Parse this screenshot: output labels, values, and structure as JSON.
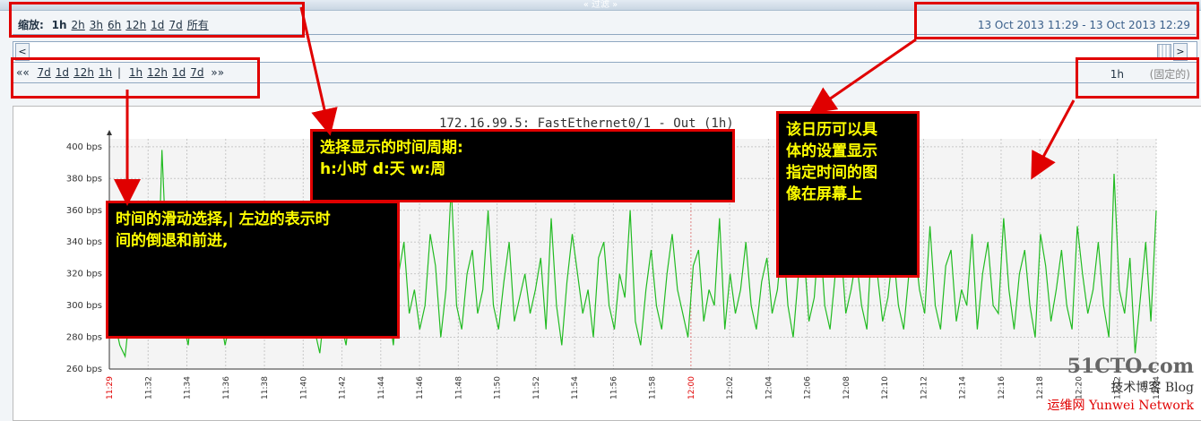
{
  "filter": {
    "label": "« 过滤 »"
  },
  "zoom": {
    "label": "缩放:",
    "options": [
      "1h",
      "2h",
      "3h",
      "6h",
      "12h",
      "1d",
      "7d",
      "所有"
    ],
    "active": "1h"
  },
  "range": {
    "start": "13 Oct 2013 11:29",
    "sep": " - ",
    "end": "13 Oct 2013 12:29"
  },
  "scroll": {
    "left": "<",
    "right": ">"
  },
  "nav": {
    "back_symbol": "««",
    "back": [
      "7d",
      "1d",
      "12h",
      "1h"
    ],
    "separator": "|",
    "forward": [
      "1h",
      "12h",
      "1d",
      "7d"
    ],
    "forward_symbol": "»»",
    "period": "1h",
    "fixed": "(固定的)"
  },
  "annotations": {
    "zoom_note": [
      "选择显示的时间周期:",
      "h:小时   d:天    w:周"
    ],
    "slide_note": [
      "时间的滑动选择,| 左边的表示时",
      "间的倒退和前进,"
    ],
    "calendar_note": [
      "该日历可以具",
      "体的设置显示",
      "指定时间的图",
      "像在屏幕上"
    ]
  },
  "watermark": {
    "main": "51CTO.com",
    "sub": "技术博客",
    "blog": "Blog",
    "brand": "运维网",
    "footer": "Yunwei Network"
  },
  "chart_data": {
    "type": "line",
    "title": "172.16.99.5: FastEthernet0/1 - Out (1h)",
    "y_tick_labels": [
      "260 bps",
      "280 bps",
      "300 bps",
      "320 bps",
      "340 bps",
      "360 bps",
      "380 bps",
      "400 bps"
    ],
    "ylim": [
      260,
      405
    ],
    "x_tick_labels": [
      "11:29",
      "11:32",
      "11:34",
      "11:36",
      "11:38",
      "11:40",
      "11:42",
      "11:44",
      "11:46",
      "11:48",
      "11:50",
      "11:52",
      "11:54",
      "11:56",
      "11:58",
      "12:00",
      "12:02",
      "12:04",
      "12:06",
      "12:08",
      "12:10",
      "12:12",
      "12:14",
      "12:16",
      "12:18",
      "12:20",
      "12:22",
      "12:24"
    ],
    "red_tick_labels": [
      "11:29",
      "12:00"
    ],
    "grid": true,
    "series": [
      {
        "color": "#22bb22",
        "values": [
          305,
          290,
          275,
          268,
          300,
          285,
          310,
          295,
          330,
          285,
          398,
          320,
          280,
          300,
          290,
          275,
          310,
          295,
          285,
          300,
          325,
          295,
          275,
          290,
          305,
          315,
          295,
          280,
          300,
          340,
          285,
          300,
          320,
          345,
          295,
          280,
          310,
          325,
          300,
          285,
          270,
          300,
          330,
          315,
          290,
          275,
          305,
          320,
          280,
          310,
          335,
          295,
          285,
          300,
          275,
          320,
          340,
          295,
          310,
          285,
          300,
          345,
          325,
          280,
          310,
          375,
          300,
          285,
          320,
          335,
          295,
          310,
          360,
          300,
          285,
          315,
          340,
          290,
          305,
          320,
          295,
          310,
          330,
          285,
          355,
          300,
          275,
          315,
          345,
          320,
          295,
          310,
          280,
          330,
          340,
          300,
          285,
          320,
          305,
          360,
          290,
          275,
          310,
          335,
          300,
          285,
          320,
          345,
          310,
          295,
          280,
          325,
          335,
          290,
          310,
          300,
          355,
          285,
          320,
          295,
          310,
          340,
          300,
          285,
          315,
          330,
          295,
          310,
          345,
          300,
          280,
          320,
          335,
          290,
          305,
          350,
          300,
          285,
          320,
          340,
          295,
          310,
          330,
          300,
          285,
          345,
          320,
          290,
          305,
          335,
          300,
          285,
          320,
          340,
          310,
          295,
          350,
          300,
          285,
          325,
          335,
          290,
          310,
          300,
          345,
          285,
          320,
          340,
          300,
          295,
          355,
          310,
          285,
          320,
          335,
          300,
          280,
          345,
          325,
          290,
          310,
          335,
          300,
          285,
          350,
          320,
          295,
          310,
          340,
          300,
          280,
          383,
          310,
          295,
          330,
          270,
          305,
          340,
          290,
          360
        ]
      }
    ]
  }
}
